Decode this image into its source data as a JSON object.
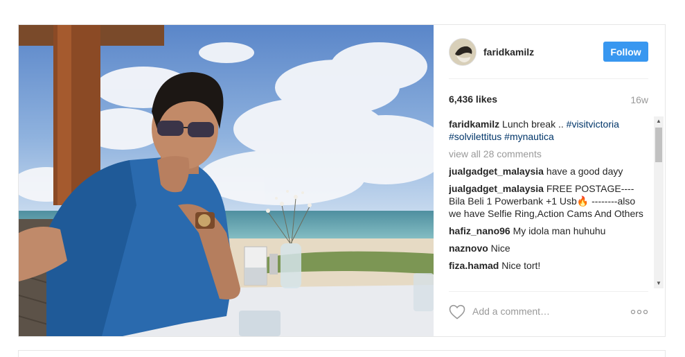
{
  "post": {
    "username": "faridkamilz",
    "follow_label": "Follow",
    "likes": "6,436 likes",
    "time_ago": "16w",
    "caption": {
      "username": "faridkamilz",
      "text": "Lunch break ..",
      "hashtags": [
        "#visitvictoria",
        "#solvilettitus",
        "#mynautica"
      ]
    },
    "view_all": "view all 28 comments",
    "comments": [
      {
        "user": "jualgadget_malaysia",
        "text": "have a good dayy"
      },
      {
        "user": "jualgadget_malaysia",
        "text": "FREE POSTAGE---- Bila Beli 1 Powerbank +1 Usb🔥 --------also we have Selfie Ring,Action Cams And Others"
      },
      {
        "user": "hafiz_nano96",
        "text": "My idola man huhuhu"
      },
      {
        "user": "naznovo",
        "text": "Nice"
      },
      {
        "user": "fiza.hamad",
        "text": "Nice tort!"
      }
    ],
    "add_comment_placeholder": "Add a comment…"
  },
  "colors": {
    "follow": "#3897f0",
    "hashtag": "#003569",
    "muted": "#999999"
  },
  "icons": {
    "like": "heart-outline-icon",
    "more": "more-options-icon",
    "scroll_up": "scroll-up-arrow",
    "scroll_down": "scroll-down-arrow"
  }
}
